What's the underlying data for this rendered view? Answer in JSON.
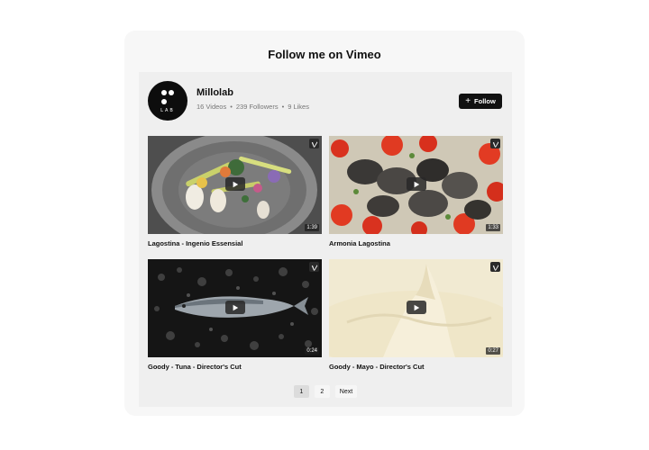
{
  "widget": {
    "title": "Follow me on Vimeo"
  },
  "channel": {
    "logo_text": "LAB",
    "name": "Millolab",
    "videos": "16 Videos",
    "followers": "239 Followers",
    "likes": "9 Likes",
    "stat_separator": "•",
    "follow_label": "Follow",
    "follow_icon": "+"
  },
  "videos": [
    {
      "title": "Lagostina - Ingenio Essensial",
      "duration": "1:39",
      "thumb_icon": "plate-vegetables-image"
    },
    {
      "title": "Armonia Lagostina",
      "duration": "1:33",
      "thumb_icon": "clams-tomatoes-image"
    },
    {
      "title": "Goody - Tuna - Director's Cut",
      "duration": "0:24",
      "thumb_icon": "tuna-on-ice-image"
    },
    {
      "title": "Goody - Mayo - Director's Cut",
      "duration": "0:27",
      "thumb_icon": "mayo-swirl-image"
    }
  ],
  "pagination": {
    "pages": [
      "1",
      "2"
    ],
    "next_label": "Next",
    "current": "1"
  },
  "colors": {
    "button_bg": "#111111",
    "panel_bg": "#efefef",
    "card_bg": "#f7f7f7"
  }
}
